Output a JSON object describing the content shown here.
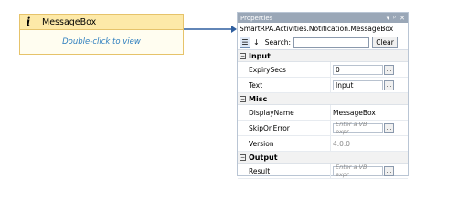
{
  "activity": {
    "title": "MessageBox",
    "hint": "Double-click to view"
  },
  "panel": {
    "title": "Properties",
    "controls": {
      "pin": "▾",
      "dock": "ᵖ",
      "close": "✕"
    },
    "type_path": "SmartRPA.Activities.Notification.MessageBox",
    "search_label": "Search:",
    "clear_label": "Clear",
    "categories": [
      {
        "name": "Input",
        "toggle": "⊟",
        "rows": [
          {
            "name": "ExpirySecs",
            "value": "0",
            "muted": false
          },
          {
            "name": "Text",
            "value": "Input",
            "muted": false
          }
        ]
      },
      {
        "name": "Misc",
        "toggle": "⊟",
        "rows": [
          {
            "name": "DisplayName",
            "value": "MessageBox",
            "muted": false
          },
          {
            "name": "SkipOnError",
            "value": "Enter a VB expr",
            "muted": true
          },
          {
            "name": "Version",
            "value": "4.0.0",
            "muted": true
          }
        ]
      },
      {
        "name": "Output",
        "toggle": "⊟",
        "rows": [
          {
            "name": "Result",
            "value": "Enter a VB expr",
            "muted": true
          }
        ]
      }
    ]
  },
  "colors": {
    "accent": "#2f7fbf",
    "card_header": "#fde9a8",
    "card_border": "#e6c36a",
    "titlebar": "#9aa7b7"
  }
}
